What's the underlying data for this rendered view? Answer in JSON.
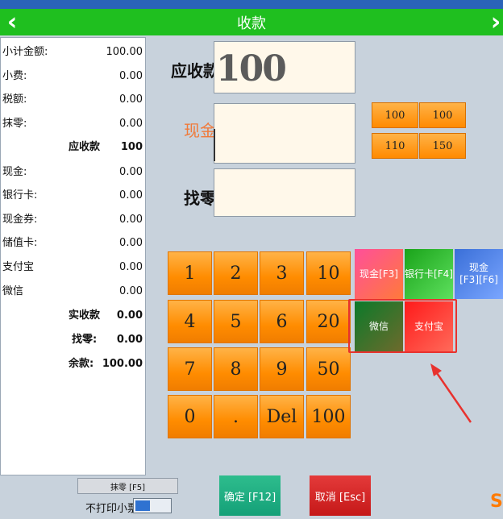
{
  "header": {
    "title": "收款",
    "back_icon": "chevron-left-icon",
    "forward_icon": "chevron-right-icon",
    "color": "#1fbf1f"
  },
  "summary": {
    "rows": [
      {
        "label": "小计金额:",
        "value": "100.00"
      },
      {
        "label": "小费:",
        "value": "0.00"
      },
      {
        "label": "税额:",
        "value": "0.00"
      },
      {
        "label": "抹零:",
        "value": "0.00"
      },
      {
        "label": "应收款",
        "value": "100"
      },
      {
        "label": "现金:",
        "value": "0.00"
      },
      {
        "label": "银行卡:",
        "value": "0.00"
      },
      {
        "label": "现金券:",
        "value": "0.00"
      },
      {
        "label": "储值卡:",
        "value": "0.00"
      },
      {
        "label": "支付宝",
        "value": "0.00"
      },
      {
        "label": "微信",
        "value": "0.00"
      },
      {
        "label": "实收款",
        "value": "0.00"
      },
      {
        "label": "找零:",
        "value": "0.00"
      },
      {
        "label": "余款:",
        "value": "100.00"
      }
    ]
  },
  "amounts": {
    "due_label": "应收款",
    "due_value": "100",
    "cash_label": "现金",
    "cash_value": "",
    "change_label": "找零",
    "change_value": ""
  },
  "quick_amounts": [
    "100",
    "100",
    "110",
    "150"
  ],
  "keypad": [
    "1",
    "2",
    "3",
    "10",
    "4",
    "5",
    "6",
    "20",
    "7",
    "8",
    "9",
    "50",
    "0",
    ".",
    "Del",
    "100"
  ],
  "payment": {
    "cash": "现金[F3]",
    "bank": "银行卡[F4]",
    "cash2_line1": "现金",
    "cash2_line2": "[F3][F6]",
    "wechat": "微信",
    "alipay": "支付宝"
  },
  "bottom": {
    "round_button": "抹零 [F5]",
    "no_print_label": "不打印小票",
    "confirm": "确定 [F12]",
    "cancel": "取消 [Esc]"
  },
  "colors": {
    "accent_orange": "#ff8c00",
    "highlight_red": "#e8322e",
    "confirm_green": "#14a078",
    "cancel_red": "#c51818"
  }
}
